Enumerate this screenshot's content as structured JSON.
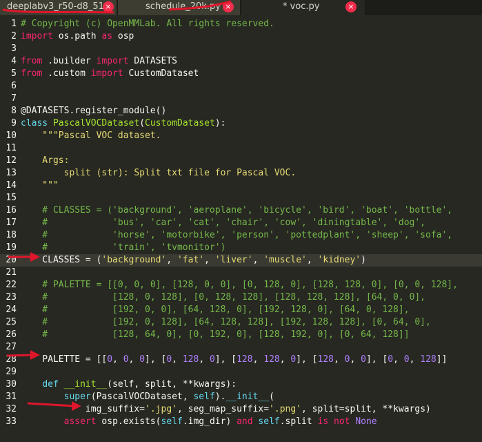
{
  "tabs": [
    {
      "label": "deeplabv3_r50-d8_51...",
      "active": false
    },
    {
      "label": "schedule_20k.py",
      "active": false
    },
    {
      "label": "* voc.py",
      "active": true
    }
  ],
  "close_glyph": "×",
  "line_numbers": [
    "1",
    "2",
    "3",
    "4",
    "5",
    "6",
    "7",
    "8",
    "9",
    "10",
    "11",
    "12",
    "13",
    "14",
    "15",
    "16",
    "17",
    "18",
    "19",
    "20",
    "21",
    "22",
    "23",
    "24",
    "25",
    "26",
    "27",
    "28",
    "29",
    "30",
    "31",
    "32",
    "33"
  ],
  "highlighted_line": 19,
  "code": [
    [
      {
        "t": "# Copyright (c) OpenMMLab. All rights reserved.",
        "c": "c"
      }
    ],
    [
      {
        "t": "import",
        "c": "k"
      },
      {
        "t": " os.path "
      },
      {
        "t": "as",
        "c": "k"
      },
      {
        "t": " osp"
      }
    ],
    [],
    [
      {
        "t": "from",
        "c": "k"
      },
      {
        "t": " .builder "
      },
      {
        "t": "import",
        "c": "k"
      },
      {
        "t": " DATASETS"
      }
    ],
    [
      {
        "t": "from",
        "c": "k"
      },
      {
        "t": " .custom "
      },
      {
        "t": "import",
        "c": "k"
      },
      {
        "t": " CustomDataset"
      }
    ],
    [],
    [],
    [
      {
        "t": "@DATASETS.register_module()"
      }
    ],
    [
      {
        "t": "class",
        "c": "b"
      },
      {
        "t": " "
      },
      {
        "t": "PascalVOCDataset",
        "c": "d"
      },
      {
        "t": "("
      },
      {
        "t": "CustomDataset",
        "c": "d"
      },
      {
        "t": "):"
      }
    ],
    [
      {
        "t": "    \"\"\"Pascal VOC dataset.",
        "c": "s"
      }
    ],
    [],
    [
      {
        "t": "    Args:",
        "c": "s"
      }
    ],
    [
      {
        "t": "        split (str): Split txt file for Pascal VOC.",
        "c": "s"
      }
    ],
    [
      {
        "t": "    \"\"\"",
        "c": "s"
      }
    ],
    [],
    [
      {
        "t": "    # CLASSES = ('background', 'aeroplane', 'bicycle', 'bird', 'boat', 'bottle',",
        "c": "c"
      }
    ],
    [
      {
        "t": "    #            'bus', 'car', 'cat', 'chair', 'cow', 'diningtable', 'dog',",
        "c": "c"
      }
    ],
    [
      {
        "t": "    #            'horse', 'motorbike', 'person', 'pottedplant', 'sheep', 'sofa',",
        "c": "c"
      }
    ],
    [
      {
        "t": "    #            'train', 'tvmonitor')",
        "c": "c"
      }
    ],
    [
      {
        "t": "    CLASSES = ("
      },
      {
        "t": "'background'",
        "c": "s"
      },
      {
        "t": ", "
      },
      {
        "t": "'fat'",
        "c": "s"
      },
      {
        "t": ", "
      },
      {
        "t": "'liver'",
        "c": "s"
      },
      {
        "t": ", "
      },
      {
        "t": "'muscle'",
        "c": "s"
      },
      {
        "t": ", "
      },
      {
        "t": "'kidney'",
        "c": "s"
      },
      {
        "t": ")"
      }
    ],
    [],
    [
      {
        "t": "    # PALETTE = [[0, 0, 0], [128, 0, 0], [0, 128, 0], [128, 128, 0], [0, 0, 128],",
        "c": "c"
      }
    ],
    [
      {
        "t": "    #            [128, 0, 128], [0, 128, 128], [128, 128, 128], [64, 0, 0],",
        "c": "c"
      }
    ],
    [
      {
        "t": "    #            [192, 0, 0], [64, 128, 0], [192, 128, 0], [64, 0, 128],",
        "c": "c"
      }
    ],
    [
      {
        "t": "    #            [192, 0, 128], [64, 128, 128], [192, 128, 128], [0, 64, 0],",
        "c": "c"
      }
    ],
    [
      {
        "t": "    #            [128, 64, 0], [0, 192, 0], [128, 192, 0], [0, 64, 128]]",
        "c": "c"
      }
    ],
    [],
    [
      {
        "t": "    PALETTE = [["
      },
      {
        "t": "0",
        "c": "n"
      },
      {
        "t": ", "
      },
      {
        "t": "0",
        "c": "n"
      },
      {
        "t": ", "
      },
      {
        "t": "0",
        "c": "n"
      },
      {
        "t": "], ["
      },
      {
        "t": "0",
        "c": "n"
      },
      {
        "t": ", "
      },
      {
        "t": "128",
        "c": "n"
      },
      {
        "t": ", "
      },
      {
        "t": "0",
        "c": "n"
      },
      {
        "t": "], ["
      },
      {
        "t": "128",
        "c": "n"
      },
      {
        "t": ", "
      },
      {
        "t": "128",
        "c": "n"
      },
      {
        "t": ", "
      },
      {
        "t": "0",
        "c": "n"
      },
      {
        "t": "], ["
      },
      {
        "t": "128",
        "c": "n"
      },
      {
        "t": ", "
      },
      {
        "t": "0",
        "c": "n"
      },
      {
        "t": ", "
      },
      {
        "t": "0",
        "c": "n"
      },
      {
        "t": "], ["
      },
      {
        "t": "0",
        "c": "n"
      },
      {
        "t": ", "
      },
      {
        "t": "0",
        "c": "n"
      },
      {
        "t": ", "
      },
      {
        "t": "128",
        "c": "n"
      },
      {
        "t": "]]"
      }
    ],
    [],
    [
      {
        "t": "    "
      },
      {
        "t": "def",
        "c": "b"
      },
      {
        "t": " "
      },
      {
        "t": "__init__",
        "c": "d"
      },
      {
        "t": "(self, split, **kwargs):"
      }
    ],
    [
      {
        "t": "        "
      },
      {
        "t": "super",
        "c": "b"
      },
      {
        "t": "(PascalVOCDataset, "
      },
      {
        "t": "self",
        "c": "b"
      },
      {
        "t": ")."
      },
      {
        "t": "__init__",
        "c": "b"
      },
      {
        "t": "("
      }
    ],
    [
      {
        "t": "            img_suffix="
      },
      {
        "t": "'.jpg'",
        "c": "s"
      },
      {
        "t": ", seg_map_suffix="
      },
      {
        "t": "'.png'",
        "c": "s"
      },
      {
        "t": ", split=split, **kwargs)"
      }
    ],
    [
      {
        "t": "        "
      },
      {
        "t": "assert",
        "c": "k"
      },
      {
        "t": " osp.exists("
      },
      {
        "t": "self",
        "c": "b"
      },
      {
        "t": ".img_dir) "
      },
      {
        "t": "and",
        "c": "k"
      },
      {
        "t": " "
      },
      {
        "t": "self",
        "c": "b"
      },
      {
        "t": ".split "
      },
      {
        "t": "is",
        "c": "k"
      },
      {
        "t": " "
      },
      {
        "t": "not",
        "c": "k"
      },
      {
        "t": " "
      },
      {
        "t": "None",
        "c": "n"
      }
    ]
  ]
}
